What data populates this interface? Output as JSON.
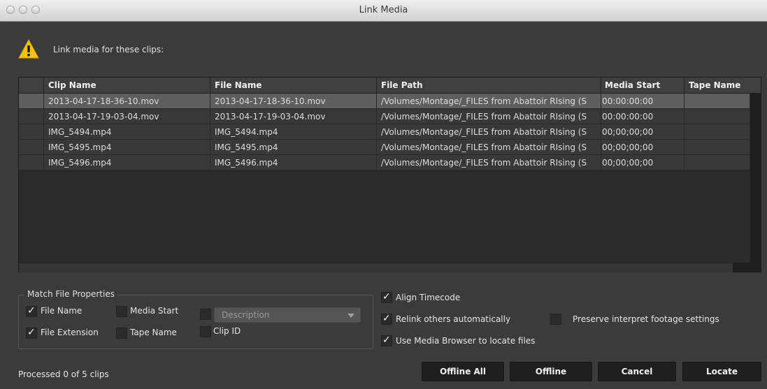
{
  "window": {
    "title": "Link Media"
  },
  "header": {
    "message": "Link media for these clips:",
    "icon": "warning-icon"
  },
  "table": {
    "columns": [
      "Clip Name",
      "File Name",
      "File Path",
      "Media Start",
      "Tape Name"
    ],
    "rows": [
      [
        "2013-04-17-18-36-10.mov",
        "2013-04-17-18-36-10.mov",
        "/Volumes/Montage/_FILES from Abattoir RIsing (S",
        "00:00:00:00",
        ""
      ],
      [
        "2013-04-17-19-03-04.mov",
        "2013-04-17-19-03-04.mov",
        "/Volumes/Montage/_FILES from Abattoir RIsing (S",
        "00:00:00:00",
        ""
      ],
      [
        "IMG_5494.mp4",
        "IMG_5494.mp4",
        "/Volumes/Montage/_FILES from Abattoir RIsing (S",
        "00;00;00;00",
        ""
      ],
      [
        "IMG_5495.mp4",
        "IMG_5495.mp4",
        "/Volumes/Montage/_FILES from Abattoir RIsing (S",
        "00;00;00;00",
        ""
      ],
      [
        "IMG_5496.mp4",
        "IMG_5496.mp4",
        "/Volumes/Montage/_FILES from Abattoir RIsing (S",
        "00;00;00;00",
        ""
      ]
    ],
    "selected_row": 0
  },
  "match": {
    "title": "Match File Properties",
    "file_name": {
      "label": "File Name",
      "checked": true
    },
    "media_start": {
      "label": "Media Start",
      "checked": false
    },
    "description": {
      "label": "Description",
      "checked": false
    },
    "file_extension": {
      "label": "File Extension",
      "checked": true
    },
    "tape_name": {
      "label": "Tape Name",
      "checked": false
    },
    "clip_id": {
      "label": "Clip ID",
      "checked": false
    }
  },
  "options": {
    "align_timecode": {
      "label": "Align Timecode",
      "checked": true
    },
    "relink_auto": {
      "label": "Relink others automatically",
      "checked": true
    },
    "preserve": {
      "label": "Preserve interpret footage settings",
      "checked": false
    },
    "media_browser": {
      "label": "Use Media Browser to locate files",
      "checked": true
    }
  },
  "status": "Processed 0 of 5 clips",
  "buttons": {
    "offline_all": "Offline All",
    "offline": "Offline",
    "cancel": "Cancel",
    "locate": "Locate"
  },
  "colors": {
    "background": "#3b3b3b",
    "selected_row": "#5e5e5e",
    "button": "#1f1f1f"
  },
  "check_glyph": "✓"
}
